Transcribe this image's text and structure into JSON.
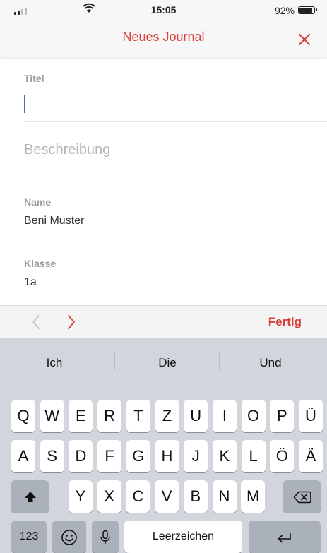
{
  "status_bar": {
    "time": "15:05",
    "battery": "92%"
  },
  "nav": {
    "title": "Neues Journal"
  },
  "form": {
    "title_label": "Titel",
    "description_placeholder": "Beschreibung",
    "name_label": "Name",
    "name_value": "Beni Muster",
    "class_label": "Klasse",
    "class_value": "1a"
  },
  "accessory": {
    "done": "Fertig"
  },
  "keyboard": {
    "suggestions": [
      "Ich",
      "Die",
      "Und"
    ],
    "row1": [
      "Q",
      "W",
      "E",
      "R",
      "T",
      "Z",
      "U",
      "I",
      "O",
      "P",
      "Ü"
    ],
    "row2": [
      "A",
      "S",
      "D",
      "F",
      "G",
      "H",
      "J",
      "K",
      "L",
      "Ö",
      "Ä"
    ],
    "row3": [
      "Y",
      "X",
      "C",
      "V",
      "B",
      "N",
      "M"
    ],
    "numbers_key": "123",
    "space_key": "Leerzeichen"
  },
  "colors": {
    "accent": "#d9403a",
    "caret": "#4f6bb8",
    "keyboard_bg": "#d2d5db"
  }
}
